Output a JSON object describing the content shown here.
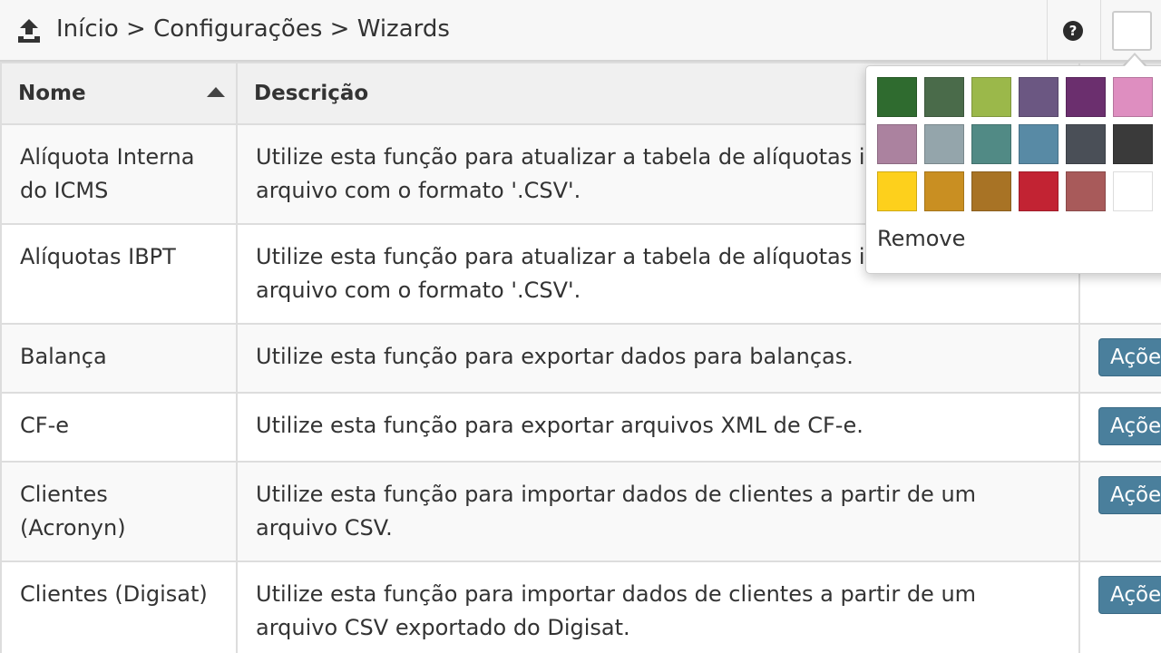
{
  "header": {
    "breadcrumb": "Início > Configurações > Wizards",
    "help_symbol": "?"
  },
  "table": {
    "columns": [
      "Nome",
      "Descrição"
    ],
    "sort_column": "Nome",
    "sort_direction": "ascending",
    "rows": [
      {
        "name": "Alíquota Interna do ICMS",
        "description": "Utilize esta função para atualizar a tabela de alíquotas in importando um arquivo com o formato '.CSV'.",
        "action": ""
      },
      {
        "name": "Alíquotas IBPT",
        "description": "Utilize esta função para atualizar a tabela de alíquotas in importando um arquivo com o formato '.CSV'.",
        "action": ""
      },
      {
        "name": "Balança",
        "description": "Utilize esta função para exportar dados para balanças.",
        "action": "Ações"
      },
      {
        "name": "CF-e",
        "description": "Utilize esta função para exportar arquivos XML de CF-e.",
        "action": "Ações"
      },
      {
        "name": "Clientes (Acronyn)",
        "description": "Utilize esta função para importar dados de clientes a partir de um arquivo CSV.",
        "action": "Ações"
      },
      {
        "name": "Clientes (Digisat)",
        "description": "Utilize esta função para importar dados de clientes a partir de um arquivo CSV exportado do Digisat.",
        "action": "Ações"
      }
    ]
  },
  "color_picker": {
    "colors": [
      "#2f6b2f",
      "#4a6b4a",
      "#9bb84a",
      "#6b5782",
      "#6b2f6e",
      "#de8ec0",
      "#ab829f",
      "#94a5ab",
      "#518a85",
      "#588aa5",
      "#4a4f57",
      "#3a3a3a",
      "#fdd01c",
      "#c98f22",
      "#a87325",
      "#c22333",
      "#a85a5a",
      "#ffffff"
    ],
    "remove_label": "Remove"
  },
  "colors": {
    "action_button": "#4a7f9c",
    "header_bg": "#f7f7f7"
  }
}
